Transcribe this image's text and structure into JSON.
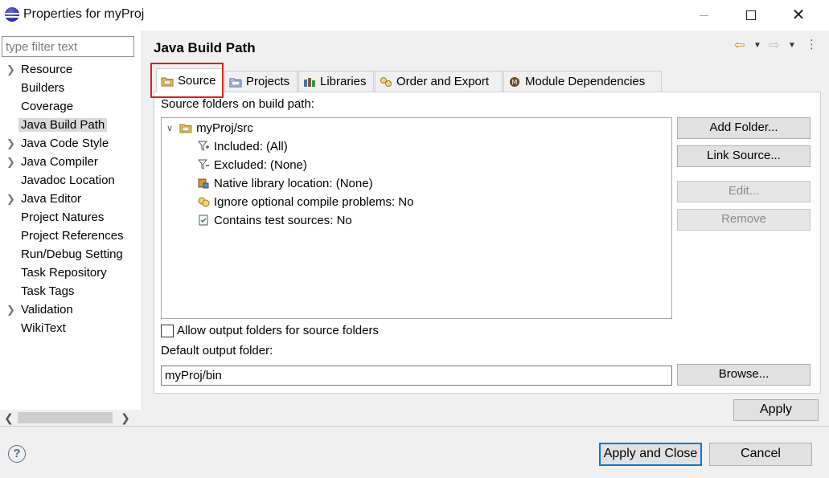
{
  "window": {
    "title": "Properties for myProj",
    "icon": "eclipse-icon"
  },
  "filter": {
    "placeholder": "type filter text",
    "value": ""
  },
  "nav": {
    "items": [
      {
        "label": "Resource",
        "expandable": true
      },
      {
        "label": "Builders",
        "expandable": false
      },
      {
        "label": "Coverage",
        "expandable": false
      },
      {
        "label": "Java Build Path",
        "expandable": false,
        "selected": true
      },
      {
        "label": "Java Code Style",
        "expandable": true
      },
      {
        "label": "Java Compiler",
        "expandable": true
      },
      {
        "label": "Javadoc Location",
        "expandable": false
      },
      {
        "label": "Java Editor",
        "expandable": true
      },
      {
        "label": "Project Natures",
        "expandable": false
      },
      {
        "label": "Project References",
        "expandable": false
      },
      {
        "label": "Run/Debug Setting",
        "expandable": false
      },
      {
        "label": "Task Repository",
        "expandable": false
      },
      {
        "label": "Task Tags",
        "expandable": false
      },
      {
        "label": "Validation",
        "expandable": true
      },
      {
        "label": "WikiText",
        "expandable": false
      }
    ]
  },
  "page": {
    "title": "Java Build Path",
    "tabs": [
      {
        "label": "Source",
        "icon": "source-folder-icon",
        "active": true
      },
      {
        "label": "Projects",
        "icon": "projects-icon"
      },
      {
        "label": "Libraries",
        "icon": "libraries-icon"
      },
      {
        "label": "Order and Export",
        "icon": "order-export-icon"
      },
      {
        "label": "Module Dependencies",
        "icon": "module-icon"
      }
    ]
  },
  "source": {
    "label": "Source folders on build path:",
    "tree": {
      "root": "myProj/src",
      "children": [
        "Included: (All)",
        "Excluded: (None)",
        "Native library location: (None)",
        "Ignore optional compile problems: No",
        "Contains test sources: No"
      ]
    },
    "buttons": {
      "add_folder": "Add Folder...",
      "link_source": "Link Source...",
      "edit": "Edit...",
      "remove": "Remove"
    },
    "allow_output_label": "Allow output folders for source folders",
    "allow_output_checked": false,
    "default_output_label": "Default output folder:",
    "default_output_value": "myProj/bin",
    "browse": "Browse..."
  },
  "footer": {
    "apply": "Apply",
    "apply_and_close": "Apply and Close",
    "cancel": "Cancel"
  },
  "colors": {
    "highlight": "#d61f1f",
    "default_button_border": "#0078d7"
  }
}
